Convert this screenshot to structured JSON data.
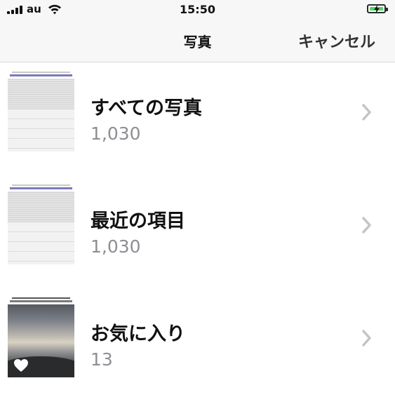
{
  "status_bar": {
    "carrier": "au",
    "time": "15:50",
    "battery_color": "#4cd964"
  },
  "nav": {
    "title": "写真",
    "cancel_label": "キャンセル"
  },
  "albums": [
    {
      "name": "すべての写真",
      "count": "1,030",
      "thumbnail": "screenshot-thumbnail"
    },
    {
      "name": "最近の項目",
      "count": "1,030",
      "thumbnail": "screenshot-thumbnail"
    },
    {
      "name": "お気に入り",
      "count": "13",
      "thumbnail": "sky-photo-thumbnail",
      "badge_icon": "heart-icon"
    }
  ],
  "icons": {
    "signal": "cellular-signal-icon",
    "wifi": "wifi-icon",
    "battery": "battery-charging-icon",
    "chevron": "chevron-right-icon"
  }
}
